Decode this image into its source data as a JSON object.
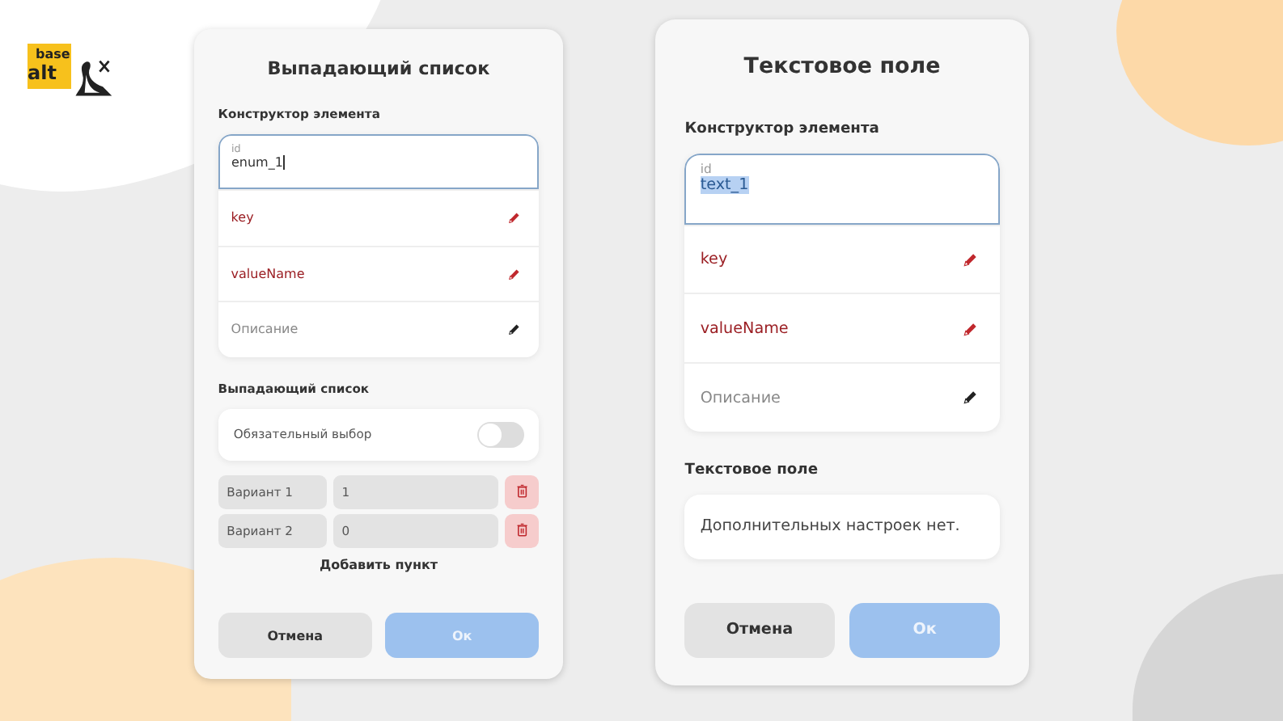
{
  "logo": {
    "line_1": "base",
    "line_2": "alt"
  },
  "dialogs": [
    {
      "kind": "dropdown",
      "title": "Выпадающий список",
      "constructor_label": "Конструктор элемента",
      "id_field": {
        "label": "id",
        "value": "enum_1",
        "text_selected": false
      },
      "properties": [
        {
          "label": "key",
          "required": true
        },
        {
          "label": "valueName",
          "required": true
        },
        {
          "label": "Описание",
          "required": false
        }
      ],
      "section_label": "Выпадающий список",
      "required_toggle": {
        "label": "Обязательный выбор",
        "on": false
      },
      "options": [
        {
          "name": "Вариант 1",
          "value": "1"
        },
        {
          "name": "Вариант 2",
          "value": "0"
        }
      ],
      "add_label": "Добавить пункт",
      "buttons": [
        {
          "label": "Отмена",
          "kind": "cancel",
          "disabled": false
        },
        {
          "label": "Ок",
          "kind": "ok",
          "disabled": true
        }
      ]
    },
    {
      "kind": "text",
      "title": "Текстовое поле",
      "constructor_label": "Конструктор элемента",
      "id_field": {
        "label": "id",
        "value": "text_1",
        "text_selected": true
      },
      "properties": [
        {
          "label": "key",
          "required": true
        },
        {
          "label": "valueName",
          "required": true
        },
        {
          "label": "Описание",
          "required": false
        }
      ],
      "section_label": "Текстовое поле",
      "note": "Дополнительных настроек нет.",
      "buttons": [
        {
          "label": "Отмена",
          "kind": "cancel",
          "disabled": false
        },
        {
          "label": "Ок",
          "kind": "ok",
          "disabled": true
        }
      ]
    }
  ]
}
